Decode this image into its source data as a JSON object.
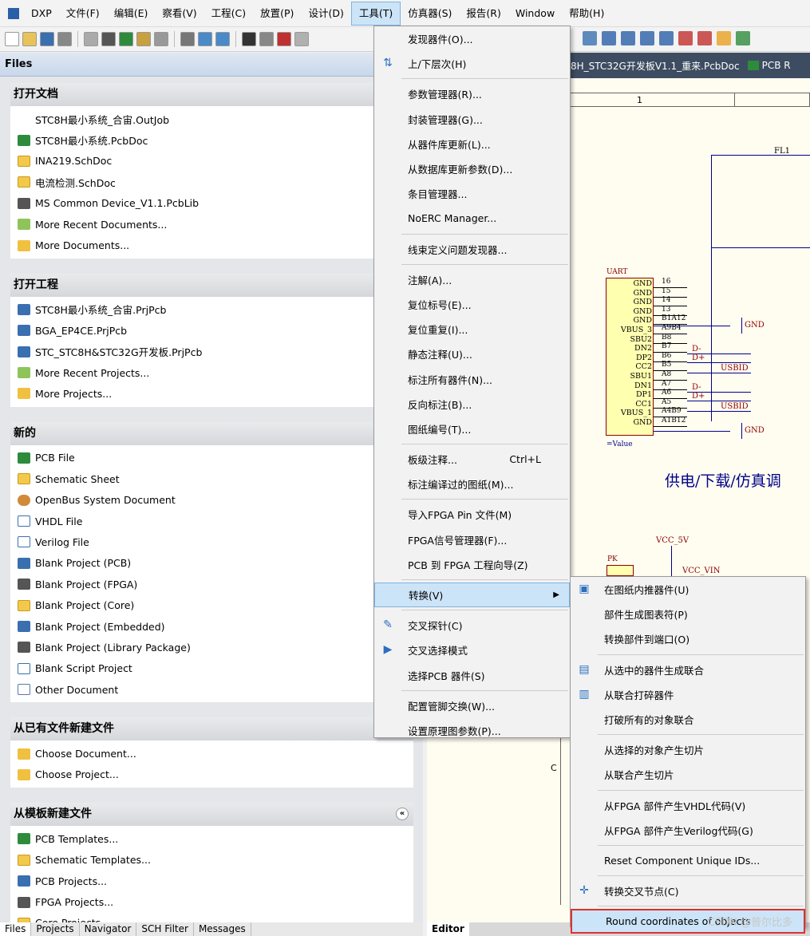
{
  "menubar": {
    "items": [
      "DXP",
      "文件(F)",
      "编辑(E)",
      "察看(V)",
      "工程(C)",
      "放置(P)",
      "设计(D)",
      "工具(T)",
      "仿真器(S)",
      "报告(R)",
      "Window",
      "帮助(H)"
    ]
  },
  "files_panel": {
    "title": "Files",
    "sections": [
      {
        "title": "打开文档",
        "items": [
          {
            "icon": "outjob",
            "label": "STC8H最小系统_合宙.OutJob"
          },
          {
            "icon": "pcb",
            "label": "STC8H最小系统.PcbDoc"
          },
          {
            "icon": "sch",
            "label": "INA219.SchDoc"
          },
          {
            "icon": "sch",
            "label": "电流检测.SchDoc"
          },
          {
            "icon": "lib",
            "label": "MS Common Device_V1.1.PcbLib"
          },
          {
            "icon": "folder",
            "label": "More Recent Documents..."
          },
          {
            "icon": "folder-open",
            "label": "More Documents..."
          }
        ]
      },
      {
        "title": "打开工程",
        "items": [
          {
            "icon": "prj",
            "label": "STC8H最小系统_合宙.PrjPcb"
          },
          {
            "icon": "prj",
            "label": "BGA_EP4CE.PrjPcb"
          },
          {
            "icon": "prj",
            "label": "STC_STC8H&STC32G开发板.PrjPcb"
          },
          {
            "icon": "folder",
            "label": "More Recent Projects..."
          },
          {
            "icon": "folder-open",
            "label": "More Projects..."
          }
        ]
      },
      {
        "title": "新的",
        "items": [
          {
            "icon": "pcb",
            "label": "PCB File"
          },
          {
            "icon": "sch",
            "label": "Schematic Sheet"
          },
          {
            "icon": "bus",
            "label": "OpenBus System Document"
          },
          {
            "icon": "vhdl",
            "label": "VHDL File"
          },
          {
            "icon": "vhdl",
            "label": "Verilog File"
          },
          {
            "icon": "prj",
            "label": "Blank Project (PCB)"
          },
          {
            "icon": "lib",
            "label": "Blank Project (FPGA)"
          },
          {
            "icon": "sch",
            "label": "Blank Project (Core)"
          },
          {
            "icon": "prj",
            "label": "Blank Project (Embedded)"
          },
          {
            "icon": "lib",
            "label": "Blank Project (Library Package)"
          },
          {
            "icon": "vhdl",
            "label": "Blank Script Project"
          },
          {
            "icon": "doc",
            "label": "Other Document"
          }
        ]
      },
      {
        "title": "从已有文件新建文件",
        "items": [
          {
            "icon": "folder-open",
            "label": "Choose Document..."
          },
          {
            "icon": "folder-open",
            "label": "Choose Project..."
          }
        ]
      },
      {
        "title": "从模板新建文件",
        "collapse": "«",
        "items": [
          {
            "icon": "pcb",
            "label": "PCB Templates..."
          },
          {
            "icon": "sch",
            "label": "Schematic Templates..."
          },
          {
            "icon": "prj",
            "label": "PCB Projects..."
          },
          {
            "icon": "lib",
            "label": "FPGA Projects..."
          },
          {
            "icon": "sch",
            "label": "Core Projects..."
          }
        ]
      }
    ]
  },
  "bottom_tabs": [
    "Files",
    "Projects",
    "Navigator",
    "SCH Filter",
    "Messages"
  ],
  "doc_tabs": [
    "8H_STC32G开发板V1.1_重来.PcbDoc",
    "PCB R"
  ],
  "editor_tab": "Editor",
  "schematic": {
    "ruler_col": "1",
    "ruler_row": "C",
    "fl": "FL1",
    "uart": "UART",
    "pins_left": [
      "GND",
      "GND",
      "GND",
      "GND",
      "GND",
      "VBUS_3",
      "SBU2",
      "DN2",
      "DP2",
      "CC2",
      "SBU1",
      "DN1",
      "DP1",
      "CC1",
      "VBUS_1",
      "GND"
    ],
    "pins_right": [
      "16",
      "15",
      "14",
      "13",
      "B1A12",
      "A9B4",
      "B8",
      "B7",
      "B6",
      "B5",
      "A8",
      "A7",
      "A6",
      "A5",
      "A4B9",
      "A1B12"
    ],
    "net_labels": [
      "D-",
      "D+",
      "USBID",
      "D-",
      "D+",
      "USBID"
    ],
    "gnd1": "GND",
    "gnd2": "GND",
    "value": "=Value",
    "title_text": "供电/下载/仿真调",
    "vcc5": "VCC_5V",
    "vccvin": "VCC_VIN",
    "pk": "PK"
  },
  "tools_menu": {
    "groups": [
      [
        {
          "label": "发现器件(O)..."
        },
        {
          "label": "上/下层次(H)",
          "icon": "⇅"
        }
      ],
      [
        {
          "label": "参数管理器(R)..."
        },
        {
          "label": "封装管理器(G)..."
        },
        {
          "label": "从器件库更新(L)..."
        },
        {
          "label": "从数据库更新参数(D)..."
        },
        {
          "label": "条目管理器..."
        },
        {
          "label": "NoERC Manager..."
        }
      ],
      [
        {
          "label": "线束定义问题发现器..."
        }
      ],
      [
        {
          "label": "注解(A)..."
        },
        {
          "label": "复位标号(E)..."
        },
        {
          "label": "复位重复(I)..."
        },
        {
          "label": "静态注释(U)..."
        },
        {
          "label": "标注所有器件(N)..."
        },
        {
          "label": "反向标注(B)..."
        },
        {
          "label": "图纸编号(T)..."
        }
      ],
      [
        {
          "label": "板级注释...",
          "shortcut": "Ctrl+L"
        },
        {
          "label": "标注编译过的图纸(M)..."
        }
      ],
      [
        {
          "label": "导入FPGA Pin 文件(M)"
        },
        {
          "label": "FPGA信号管理器(F)..."
        },
        {
          "label": "PCB 到 FPGA 工程向导(Z)"
        }
      ],
      [
        {
          "label": "转换(V)",
          "submenu": "▶",
          "highlight": true
        }
      ],
      [
        {
          "label": "交叉探针(C)",
          "icon": "✎"
        },
        {
          "label": "交叉选择模式",
          "icon": "▶"
        },
        {
          "label": "选择PCB 器件(S)"
        }
      ],
      [
        {
          "label": "配置管脚交换(W)..."
        },
        {
          "label": "设置原理图参数(P)..."
        }
      ]
    ]
  },
  "convert_menu": {
    "groups": [
      [
        {
          "label": "在图纸内推器件(U)",
          "icon": "▣"
        },
        {
          "label": "部件生成图表符(P)"
        },
        {
          "label": "转换部件到端口(O)"
        }
      ],
      [
        {
          "label": "从选中的器件生成联合",
          "icon": "▤"
        },
        {
          "label": "从联合打碎器件",
          "icon": "▥"
        },
        {
          "label": "打破所有的对象联合"
        }
      ],
      [
        {
          "label": "从选择的对象产生切片"
        },
        {
          "label": "从联合产生切片"
        }
      ],
      [
        {
          "label": "从FPGA 部件产生VHDL代码(V)"
        },
        {
          "label": "从FPGA 部件产生Verilog代码(G)"
        }
      ],
      [
        {
          "label": "Reset Component Unique IDs..."
        }
      ],
      [
        {
          "label": "转换交叉节点(C)",
          "icon": "✛"
        }
      ],
      [
        {
          "label": "Round coordinates of objects",
          "boxed": true
        }
      ]
    ],
    "watermark": "CSDN @普尔比多"
  }
}
